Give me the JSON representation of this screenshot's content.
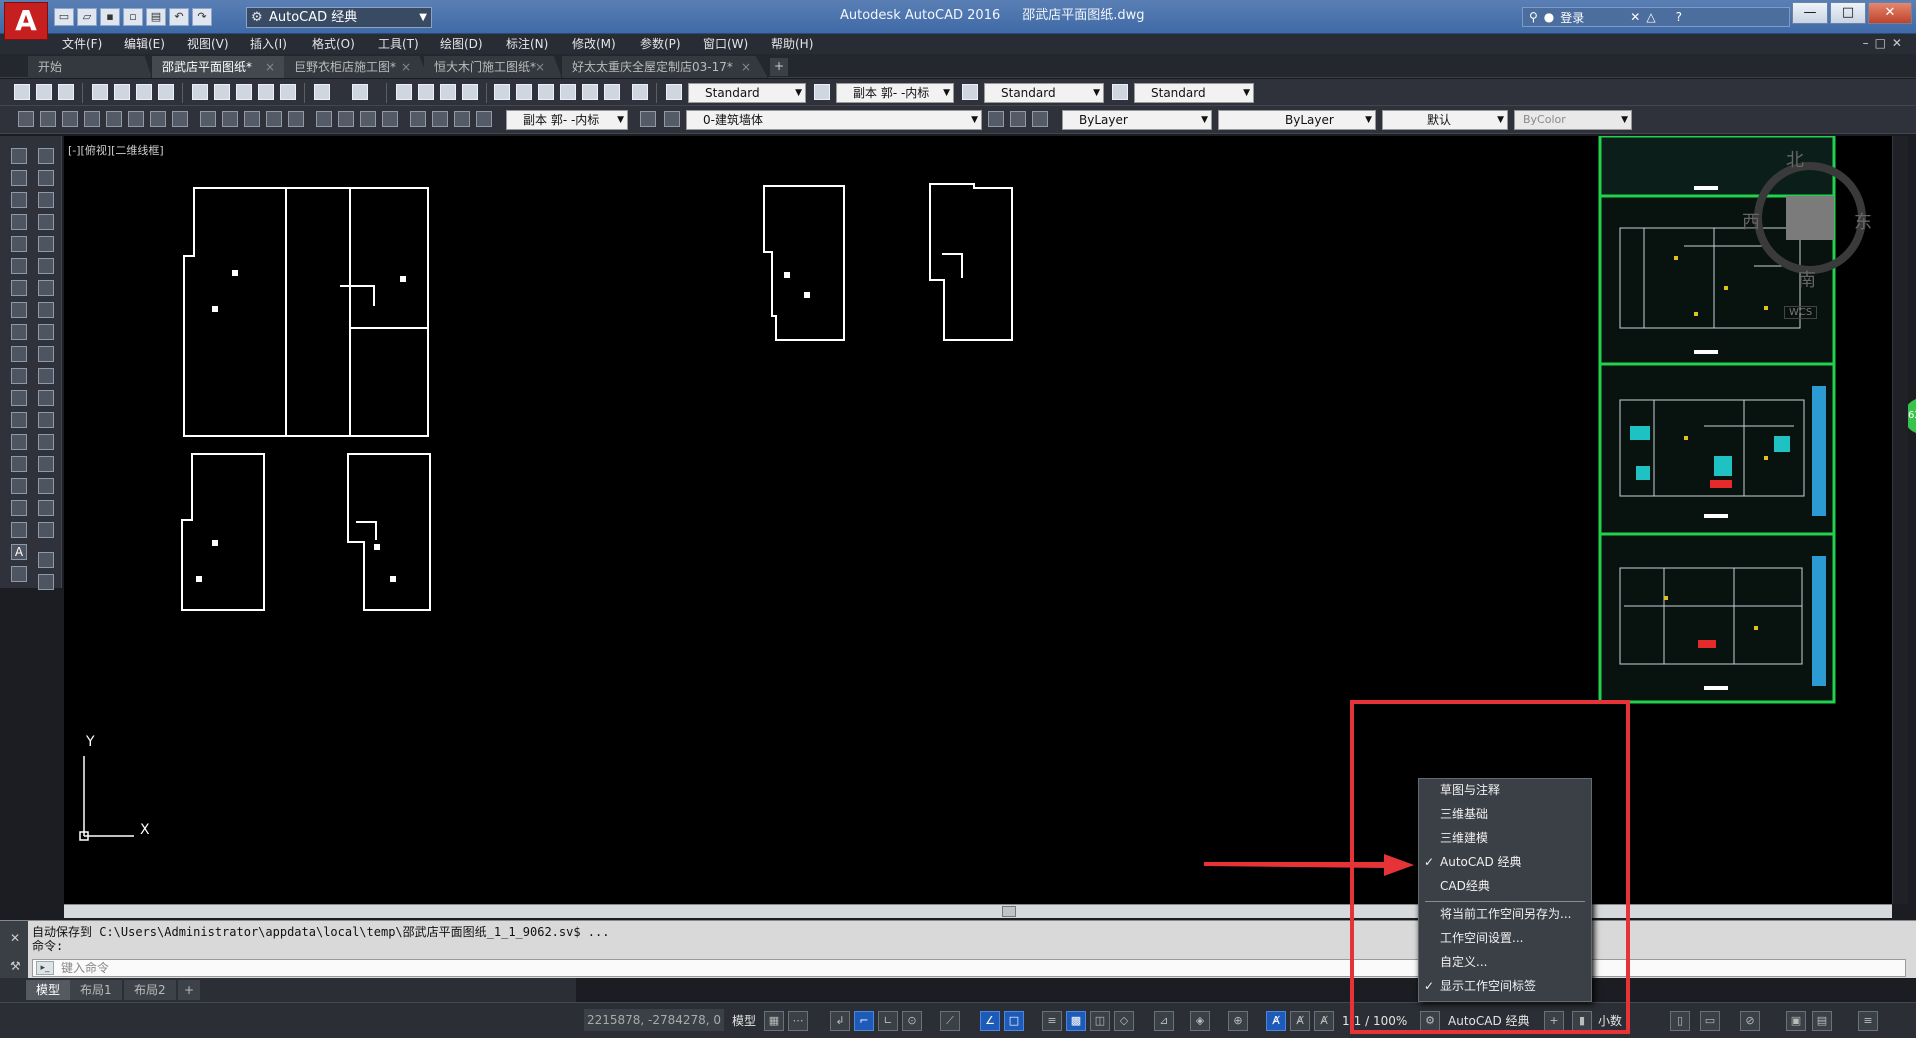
{
  "titlebar": {
    "logo": "A",
    "workspace_selector": "AutoCAD 经典",
    "app_name": "Autodesk AutoCAD 2016",
    "file_name": "邵武店平面图纸.dwg",
    "login": "登录",
    "help": "?",
    "minimize": "—",
    "maximize": "□",
    "close": "✕"
  },
  "menu": [
    "文件(F)",
    "编辑(E)",
    "视图(V)",
    "插入(I)",
    "格式(O)",
    "工具(T)",
    "绘图(D)",
    "标注(N)",
    "修改(M)",
    "参数(P)",
    "窗口(W)",
    "帮助(H)"
  ],
  "doc_tabs": [
    {
      "label": "开始",
      "close": ""
    },
    {
      "label": "邵武店平面图纸*",
      "close": "×"
    },
    {
      "label": "巨野衣柜店施工图*",
      "close": "×"
    },
    {
      "label": "恒大木门施工图纸*",
      "close": "×"
    },
    {
      "label": "好太太重庆全屋定制店03-17*",
      "close": "×"
    }
  ],
  "doc_tab_plus": "+",
  "toolbar1": {
    "text_style": "Standard",
    "dim_style": "副本 郭- -内标",
    "table_style": "Standard",
    "mleader_style": "Standard"
  },
  "toolbar2": {
    "dim_style": "副本 郭- -内标",
    "layer": "0-建筑墙体",
    "color": "ByLayer",
    "linetype": "ByLayer",
    "lineweight": "默认",
    "plotstyle": "ByColor"
  },
  "canvas": {
    "view_label": "[-][俯视][二维线框]",
    "compass": {
      "north": "北",
      "west": "西",
      "east": "东",
      "south": "南"
    },
    "wcs": "WCS",
    "ucs_x": "X",
    "ucs_y": "Y",
    "badge": "62"
  },
  "command": {
    "history_line1": "自动保存到 C:\\Users\\Administrator\\appdata\\local\\temp\\邵武店平面图纸_1_1_9062.sv$ ...",
    "history_line2": "命令:",
    "placeholder": "键入命令"
  },
  "layout_tabs": [
    "模型",
    "布局1",
    "布局2"
  ],
  "layout_tab_plus": "+",
  "statusbar": {
    "coords": "2215878, -2784278, 0",
    "model": "模型",
    "scale": "1:1 / 100%",
    "workspace": "AutoCAD 经典",
    "units": "小数"
  },
  "workspace_menu": {
    "items": [
      {
        "label": "草图与注释",
        "checked": false
      },
      {
        "label": "三维基础",
        "checked": false
      },
      {
        "label": "三维建模",
        "checked": false
      },
      {
        "label": "AutoCAD 经典",
        "checked": true
      },
      {
        "label": "CAD经典",
        "checked": false
      },
      {
        "label": "将当前工作空间另存为...",
        "checked": false
      },
      {
        "label": "工作空间设置...",
        "checked": false
      },
      {
        "label": "自定义...",
        "checked": false
      },
      {
        "label": "显示工作空间标签",
        "checked": true
      }
    ],
    "check_mark": "✓"
  },
  "colors": {
    "accent": "#e53337",
    "thumb_border": "#22d14d"
  }
}
